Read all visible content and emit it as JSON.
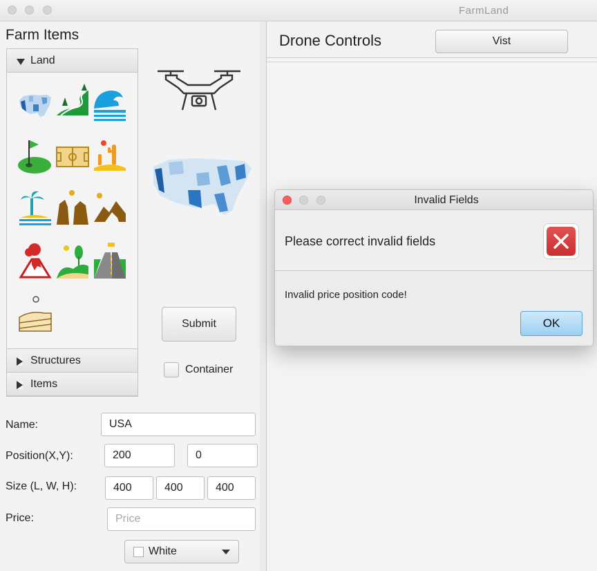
{
  "window": {
    "title": "FarmLand"
  },
  "farm_panel": {
    "title": "Farm Items",
    "sections": [
      {
        "label": "Land",
        "expanded": true
      },
      {
        "label": "Structures",
        "expanded": false
      },
      {
        "label": "Items",
        "expanded": false
      }
    ],
    "land_icons": [
      "us-map-icon",
      "winding-road-icon",
      "ocean-wave-icon",
      "golf-course-icon",
      "soccer-field-icon",
      "desert-cactus-icon",
      "tropical-island-icon",
      "canyon-icon",
      "mountain-cliff-icon",
      "volcano-icon",
      "green-hills-icon",
      "highway-icon",
      "farm-field-icon"
    ],
    "submit_label": "Submit",
    "container_label": "Container",
    "form": {
      "name_label": "Name:",
      "name_value": "USA",
      "position_label": "Position(X,Y):",
      "position_x": "200",
      "position_y": "0",
      "size_label": "Size (L, W, H):",
      "size_l": "400",
      "size_w": "400",
      "size_h": "400",
      "price_label": "Price:",
      "price_placeholder": "Price",
      "color_value": "White"
    }
  },
  "drone_panel": {
    "title": "Drone Controls",
    "visit_label": "Vist"
  },
  "dialog": {
    "title": "Invalid Fields",
    "heading": "Please correct invalid fields",
    "message": "Invalid price position code!",
    "ok_label": "OK"
  },
  "colors": {
    "accent_blue": "#9cd0f1",
    "error_red": "#d63c3c",
    "close_red": "#fc605c"
  }
}
